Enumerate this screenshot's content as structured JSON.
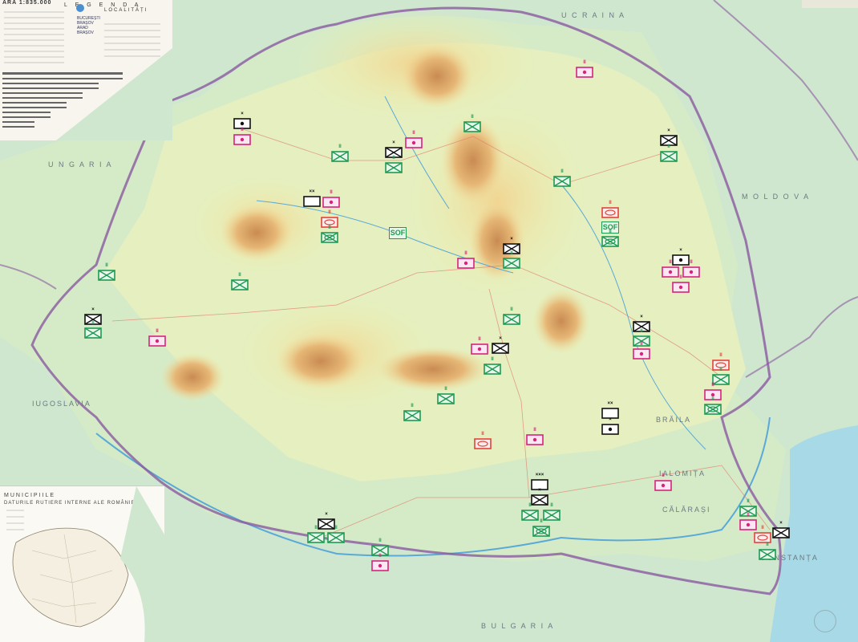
{
  "legend": {
    "scale_title": "ARA 1:835.000",
    "legend_title": "L E G E N D A",
    "localities_title": "LOCALITĂȚI",
    "cities": [
      "BUCUREȘTI",
      "BRAȘOV",
      "ARAD",
      "BRAȘOV"
    ]
  },
  "inset": {
    "heading": "MUNICIPIILE",
    "subheading": "DATURILE RUTIERE INTERNE ALE ROMÂNIEI"
  },
  "map_labels": {
    "yugoslavia": "IUGOSLAVIA",
    "moldova": "M O L D O V A",
    "braila": "BRĂILA",
    "ialomita": "IALOMIȚA",
    "calarasi": "CĂLĂRAȘI",
    "constanta": "CONSTANȚA",
    "bulgaria": "B U L G A R I A",
    "ucraina": "U C R A I N A",
    "ungaria": "U N G A R I A"
  },
  "sof_label": "SOF",
  "colors": {
    "friendly_maneuver": "#1f9a52",
    "support_magenta": "#d6247e",
    "support_red": "#e0443c",
    "command_black": "#111111",
    "border_purple": "#8a5aa0"
  },
  "symbols": {
    "infantry": "crossed-rectangle",
    "mech_infantry": "crossed-rectangle-with-oval",
    "armor": "oval-in-rectangle",
    "hq_point": "dot-in-rectangle",
    "special_operations": "SOF",
    "unit_size_markers": [
      "×",
      "××",
      "×××",
      "II"
    ]
  },
  "units": [
    {
      "type": "hq",
      "color": "black",
      "echelon": "×"
    },
    {
      "type": "support",
      "color": "magenta",
      "echelon": "II"
    },
    {
      "type": "infantry",
      "color": "green",
      "echelon": "II"
    },
    {
      "type": "inf_hq",
      "color": "black",
      "echelon": "×"
    },
    {
      "type": "infantry",
      "color": "green",
      "echelon": "II"
    },
    {
      "type": "support",
      "color": "magenta",
      "echelon": "II"
    },
    {
      "type": "infantry",
      "color": "green",
      "echelon": "II"
    },
    {
      "type": "support",
      "color": "magenta",
      "echelon": "II"
    },
    {
      "type": "infantry",
      "color": "green",
      "echelon": "II"
    },
    {
      "type": "inf_hq",
      "color": "black",
      "echelon": "×"
    },
    {
      "type": "infantry",
      "color": "green",
      "echelon": "II"
    },
    {
      "type": "blank_hq",
      "color": "black",
      "echelon": "××"
    },
    {
      "type": "support",
      "color": "magenta",
      "echelon": "II"
    },
    {
      "type": "armor",
      "color": "red",
      "echelon": "II"
    },
    {
      "type": "mech",
      "color": "green",
      "echelon": "II"
    },
    {
      "type": "armor",
      "color": "red",
      "echelon": "II"
    },
    {
      "type": "mech",
      "color": "green",
      "echelon": "II"
    },
    {
      "type": "inf_hq",
      "color": "black",
      "echelon": "×"
    },
    {
      "type": "infantry",
      "color": "green",
      "echelon": "II"
    },
    {
      "type": "support",
      "color": "magenta",
      "echelon": "II"
    },
    {
      "type": "hq",
      "color": "black",
      "echelon": "×"
    },
    {
      "type": "support",
      "color": "magenta",
      "echelon": "II"
    },
    {
      "type": "support",
      "color": "magenta",
      "echelon": "II"
    },
    {
      "type": "support",
      "color": "magenta",
      "echelon": "II"
    },
    {
      "type": "infantry",
      "color": "green",
      "echelon": "II"
    },
    {
      "type": "infantry",
      "color": "green",
      "echelon": "II"
    },
    {
      "type": "inf_hq",
      "color": "black",
      "echelon": "×"
    },
    {
      "type": "infantry",
      "color": "green",
      "echelon": "II"
    },
    {
      "type": "support",
      "color": "magenta",
      "echelon": "II"
    },
    {
      "type": "infantry",
      "color": "green",
      "echelon": "II"
    },
    {
      "type": "support",
      "color": "magenta",
      "echelon": "II"
    },
    {
      "type": "inf_hq",
      "color": "black",
      "echelon": "×"
    },
    {
      "type": "infantry",
      "color": "green",
      "echelon": "II"
    },
    {
      "type": "inf_hq",
      "color": "black",
      "echelon": "×"
    },
    {
      "type": "infantry",
      "color": "green",
      "echelon": "II"
    },
    {
      "type": "support",
      "color": "magenta",
      "echelon": "II"
    },
    {
      "type": "armor",
      "color": "red",
      "echelon": "II"
    },
    {
      "type": "infantry",
      "color": "green",
      "echelon": "II"
    },
    {
      "type": "support",
      "color": "magenta",
      "echelon": "II"
    },
    {
      "type": "mech",
      "color": "green",
      "echelon": "II"
    },
    {
      "type": "infantry",
      "color": "green",
      "echelon": "II"
    },
    {
      "type": "infantry",
      "color": "green",
      "echelon": "II"
    },
    {
      "type": "blank_hq",
      "color": "black",
      "echelon": "××"
    },
    {
      "type": "hq",
      "color": "black",
      "echelon": "×"
    },
    {
      "type": "armor",
      "color": "red",
      "echelon": "II"
    },
    {
      "type": "support",
      "color": "magenta",
      "echelon": "II"
    },
    {
      "type": "blank_hq",
      "color": "black",
      "echelon": "×××"
    },
    {
      "type": "inf_hq",
      "color": "black",
      "echelon": "×"
    },
    {
      "type": "infantry",
      "color": "green",
      "echelon": "II"
    },
    {
      "type": "infantry",
      "color": "green",
      "echelon": "II"
    },
    {
      "type": "mech",
      "color": "green",
      "echelon": "II"
    },
    {
      "type": "support",
      "color": "magenta",
      "echelon": "II"
    },
    {
      "type": "inf_hq",
      "color": "black",
      "echelon": "×"
    },
    {
      "type": "infantry",
      "color": "green",
      "echelon": "II"
    },
    {
      "type": "infantry",
      "color": "green",
      "echelon": "II"
    },
    {
      "type": "infantry",
      "color": "green",
      "echelon": "II"
    },
    {
      "type": "support",
      "color": "magenta",
      "echelon": "II"
    },
    {
      "type": "infantry",
      "color": "green",
      "echelon": "II"
    },
    {
      "type": "support",
      "color": "magenta",
      "echelon": "II"
    },
    {
      "type": "armor",
      "color": "red",
      "echelon": "II"
    },
    {
      "type": "inf_hq",
      "color": "black",
      "echelon": "×"
    },
    {
      "type": "infantry",
      "color": "green",
      "echelon": "II"
    }
  ]
}
